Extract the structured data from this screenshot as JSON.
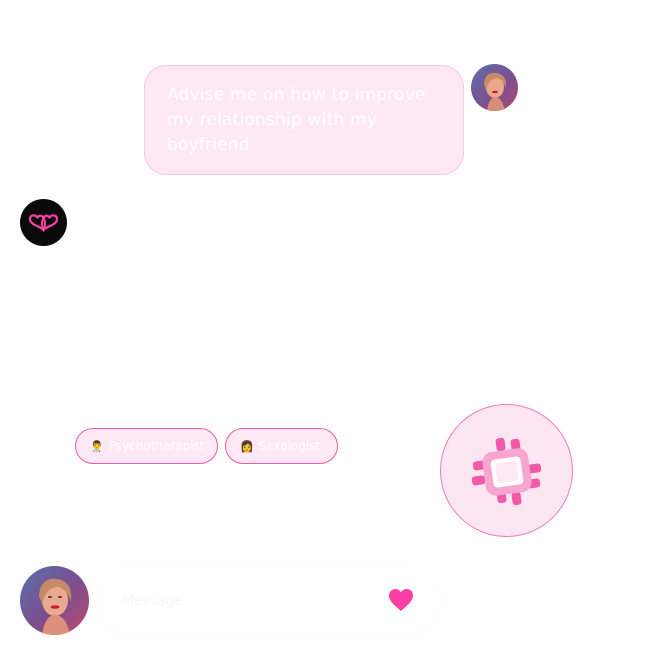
{
  "conversation": {
    "user_message": "Advise me on how to improve my relationship with my boyfriend"
  },
  "suggestions": [
    {
      "emoji": "👨‍⚕️",
      "label": "Psychotherapist"
    },
    {
      "emoji": "👩",
      "label": "Sexologist"
    }
  ],
  "input": {
    "placeholder": "Message"
  },
  "icons": {
    "bot_avatar": "hearts-logo-icon",
    "fab": "processor-chip-icon",
    "send": "heart-icon"
  },
  "colors": {
    "accent": "#ff3ea5",
    "bubble_bg": "#fde8f3",
    "chip_border": "#ea5aa7",
    "fab_bg": "#fbe6f1"
  }
}
